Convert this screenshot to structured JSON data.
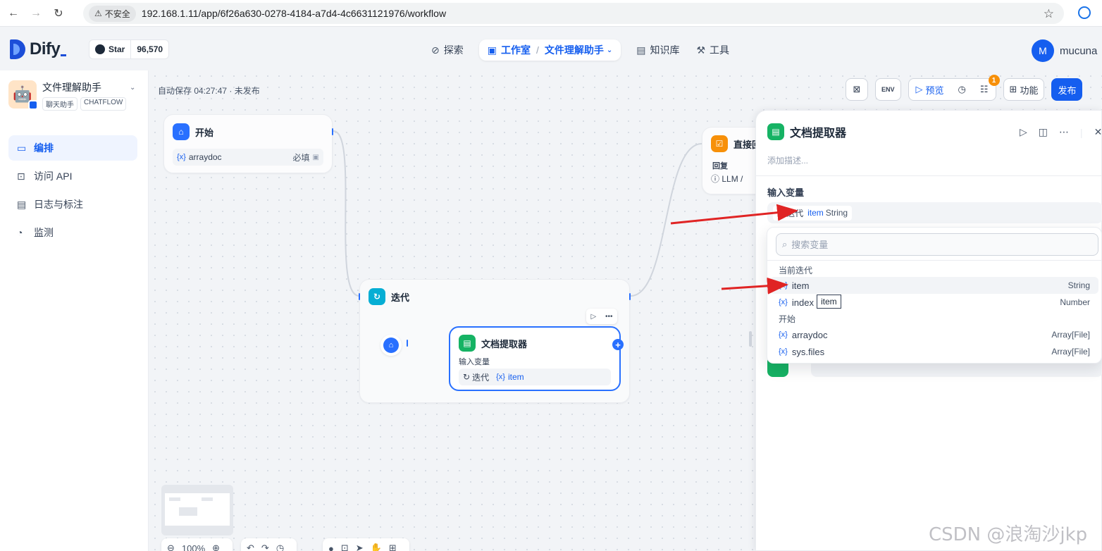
{
  "browser": {
    "insecure_label": "不安全",
    "url": "192.168.1.11/app/6f26a630-0278-4184-a7d4-4c6631121976/workflow"
  },
  "header": {
    "logo_text": "Dify",
    "github_star_label": "Star",
    "github_star_count": "96,570",
    "nav": {
      "explore": "探索",
      "studio": "工作室",
      "current_app": "文件理解助手",
      "knowledge": "知识库",
      "tools": "工具"
    },
    "user_initial": "M",
    "user_name": "mucuna"
  },
  "sidebar": {
    "app_name": "文件理解助手",
    "tags": [
      "聊天助手",
      "CHATFLOW"
    ],
    "items": [
      {
        "label": "编排",
        "icon": "layout-icon",
        "active": true
      },
      {
        "label": "访问 API",
        "icon": "terminal-icon",
        "active": false
      },
      {
        "label": "日志与标注",
        "icon": "file-list-icon",
        "active": false
      },
      {
        "label": "监测",
        "icon": "dashboard-icon",
        "active": false
      }
    ]
  },
  "canvas": {
    "autosave": "自动保存 04:27:47 · 未发布",
    "toolbar": {
      "preview": "预览",
      "features": "功能",
      "publish": "发布",
      "notification_count": "1"
    },
    "start_node": {
      "title": "开始",
      "var_name": "arraydoc",
      "required": "必填"
    },
    "answer_node": {
      "title": "直接回",
      "reply_label": "回复",
      "reply_value": "LLM /"
    },
    "iteration_node": {
      "title": "迭代"
    },
    "doc_node": {
      "title": "文档提取器",
      "input_label": "输入变量",
      "source": "迭代",
      "var": "item"
    }
  },
  "panel": {
    "title": "文档提取器",
    "description_placeholder": "添加描述...",
    "input_var_label": "输入变量",
    "selected_source": "迭代",
    "selected_var": "item",
    "selected_type": "String",
    "search_placeholder": "搜索变量",
    "groups": [
      {
        "label": "当前迭代",
        "items": [
          {
            "name": "item",
            "type": "String"
          },
          {
            "name": "index",
            "type": "Number"
          }
        ]
      },
      {
        "label": "开始",
        "items": [
          {
            "name": "arraydoc",
            "type": "Array[File]"
          },
          {
            "name": "sys.files",
            "type": "Array[File]"
          }
        ]
      }
    ],
    "tooltip": "item"
  },
  "bottom": {
    "zoom": "100%"
  },
  "watermark": "CSDN @浪淘沙jkp",
  "colors": {
    "accent": "#155eef",
    "arrow": "#e02424"
  }
}
